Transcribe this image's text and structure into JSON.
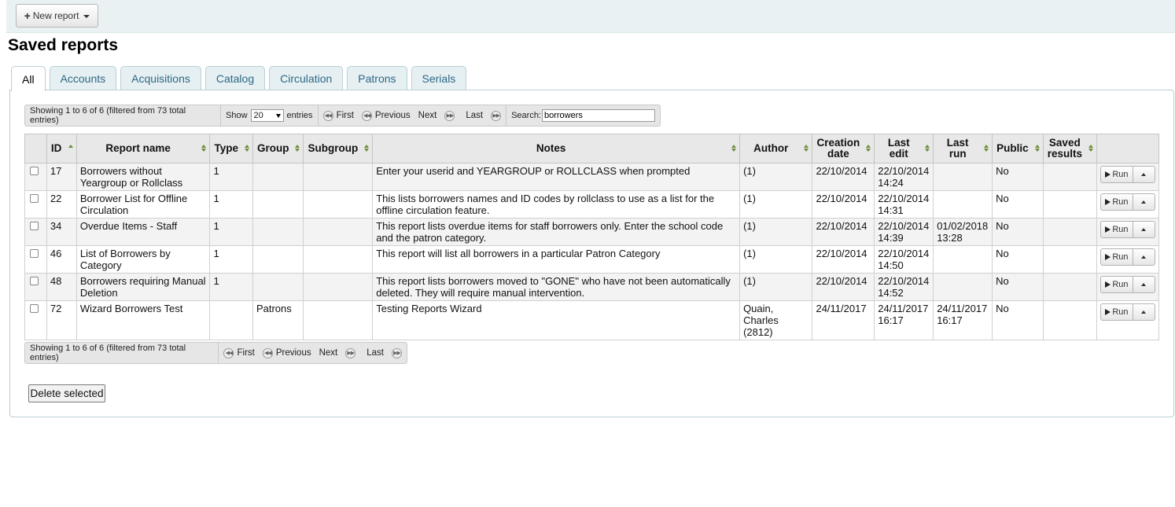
{
  "toolbar": {
    "new_report_label": "New report"
  },
  "page_title": "Saved reports",
  "tabs": [
    {
      "label": "All",
      "active": true
    },
    {
      "label": "Accounts"
    },
    {
      "label": "Acquisitions"
    },
    {
      "label": "Catalog"
    },
    {
      "label": "Circulation"
    },
    {
      "label": "Patrons"
    },
    {
      "label": "Serials"
    }
  ],
  "datatable": {
    "info": "Showing 1 to 6 of 6 (filtered from 73 total entries)",
    "show_label": "Show",
    "length_value": "20",
    "entries_label": "entries",
    "first": "First",
    "previous": "Previous",
    "next": "Next",
    "last": "Last",
    "search_label": "Search:",
    "search_value": "borrowers"
  },
  "columns": [
    "ID",
    "Report name",
    "Type",
    "Group",
    "Subgroup",
    "Notes",
    "Author",
    "Creation date",
    "Last edit",
    "Last run",
    "Public",
    "Saved results"
  ],
  "rows": [
    {
      "id": "17",
      "name": "Borrowers without Yeargroup or Rollclass",
      "type": "1",
      "group": "",
      "subgroup": "",
      "notes": "Enter your userid and YEARGROUP or ROLLCLASS when prompted",
      "author": "(1)",
      "created": "22/10/2014",
      "edited": "22/10/2014 14:24",
      "last_run": "",
      "public": "No",
      "saved": ""
    },
    {
      "id": "22",
      "name": "Borrower List for Offline Circulation",
      "type": "1",
      "group": "",
      "subgroup": "",
      "notes": "This lists borrowers names and ID codes by rollclass to use as a list for the offline circulation feature.",
      "author": "(1)",
      "created": "22/10/2014",
      "edited": "22/10/2014 14:31",
      "last_run": "",
      "public": "No",
      "saved": ""
    },
    {
      "id": "34",
      "name": "Overdue Items - Staff",
      "type": "1",
      "group": "",
      "subgroup": "",
      "notes": "This report lists overdue items for staff borrowers only. Enter the school code and the patron category.",
      "author": "(1)",
      "created": "22/10/2014",
      "edited": "22/10/2014 14:39",
      "last_run": "01/02/2018 13:28",
      "public": "No",
      "saved": ""
    },
    {
      "id": "46",
      "name": "List of Borrowers by Category",
      "type": "1",
      "group": "",
      "subgroup": "",
      "notes": "This report will list all borrowers in a particular Patron Category",
      "author": "(1)",
      "created": "22/10/2014",
      "edited": "22/10/2014 14:50",
      "last_run": "",
      "public": "No",
      "saved": ""
    },
    {
      "id": "48",
      "name": "Borrowers requiring Manual Deletion",
      "type": "1",
      "group": "",
      "subgroup": "",
      "notes": "This report lists borrowers moved to \"GONE\" who have not been automatically deleted. They will require manual intervention.",
      "author": "(1)",
      "created": "22/10/2014",
      "edited": "22/10/2014 14:52",
      "last_run": "",
      "public": "No",
      "saved": ""
    },
    {
      "id": "72",
      "name": "Wizard Borrowers Test",
      "type": "",
      "group": "Patrons",
      "subgroup": "",
      "notes": "Testing Reports Wizard",
      "author": "Quain, Charles (2812)",
      "created": "24/11/2017",
      "edited": "24/11/2017 16:17",
      "last_run": "24/11/2017 16:17",
      "public": "No",
      "saved": ""
    }
  ],
  "run_label": "Run",
  "delete_selected_label": "Delete selected"
}
